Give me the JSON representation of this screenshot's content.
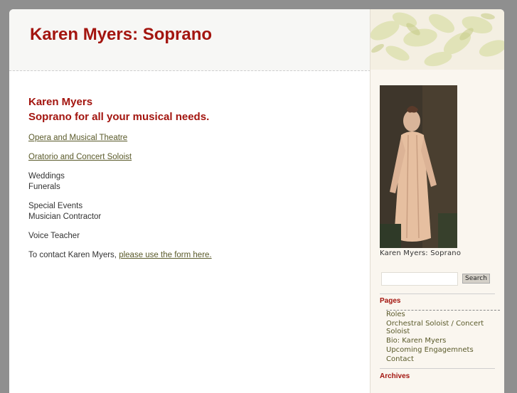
{
  "header": {
    "site_title": "Karen Myers: Soprano"
  },
  "main": {
    "heading_line1": "Karen Myers",
    "heading_line2": "Soprano for all your musical needs.",
    "link_opera": "Opera and Musical Theatre",
    "link_oratorio": "Oratorio and Concert Soloist",
    "line_weddings": "Weddings",
    "line_funerals": "Funerals",
    "line_special_events": "Special Events",
    "line_musician_contractor": "Musician Contractor",
    "line_voice_teacher": "Voice Teacher",
    "contact_prefix": "To contact Karen Myers, ",
    "contact_link": "please use the form here."
  },
  "sidebar": {
    "photo_caption": "Karen Myers: Soprano",
    "search_placeholder": "",
    "search_button": "Search",
    "pages_heading": "Pages",
    "pages": [
      "Roles",
      "Orchestral Soloist / Concert Soloist",
      "Bio: Karen Myers",
      "Upcoming Engagemnets",
      "Contact"
    ],
    "archives_heading": "Archives"
  },
  "colors": {
    "accent": "#a3150f",
    "link": "#5a5a2a",
    "frame": "#8f8f8f"
  }
}
